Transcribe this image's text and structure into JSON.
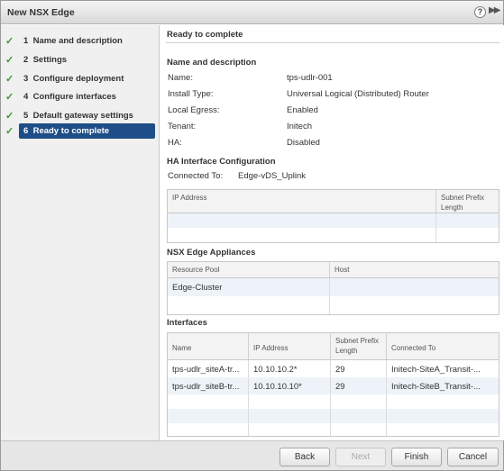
{
  "window": {
    "title": "New NSX Edge",
    "help_glyph": "?",
    "expand_glyph": "▶▶"
  },
  "steps": [
    {
      "num": "1",
      "label": "Name and description",
      "done": true
    },
    {
      "num": "2",
      "label": "Settings",
      "done": true
    },
    {
      "num": "3",
      "label": "Configure deployment",
      "done": true
    },
    {
      "num": "4",
      "label": "Configure interfaces",
      "done": true
    },
    {
      "num": "5",
      "label": "Default gateway settings",
      "done": true
    },
    {
      "num": "6",
      "label": "Ready to complete",
      "done": true,
      "active": true
    }
  ],
  "check_glyph": "✓",
  "page": {
    "title": "Ready to complete",
    "name_section": {
      "heading": "Name and description",
      "rows": [
        {
          "label": "Name:",
          "value": "tps-udlr-001"
        },
        {
          "label": "Install Type:",
          "value": "Universal Logical (Distributed) Router"
        },
        {
          "label": "Local Egress:",
          "value": "Enabled"
        },
        {
          "label": "Tenant:",
          "value": "Initech"
        },
        {
          "label": "HA:",
          "value": "Disabled"
        }
      ]
    },
    "ha_section": {
      "heading": "HA Interface Configuration",
      "connected_label": "Connected To:",
      "connected_value": "Edge-vDS_Uplink",
      "columns": [
        "IP Address",
        "Subnet Prefix Length"
      ]
    },
    "appliances_section": {
      "heading": "NSX Edge Appliances",
      "columns": [
        "Resource Pool",
        "Host"
      ],
      "rows": [
        {
          "resource_pool": "Edge-Cluster",
          "host": ""
        }
      ]
    },
    "interfaces_section": {
      "heading": "Interfaces",
      "columns": [
        "Name",
        "IP Address",
        "Subnet Prefix Length",
        "Connected To"
      ],
      "rows": [
        {
          "name": "tps-udlr_siteA-tr...",
          "ip": "10.10.10.2*",
          "prefix": "29",
          "connected": "Initech-SiteA_Transit-..."
        },
        {
          "name": "tps-udlr_siteB-tr...",
          "ip": "10.10.10.10*",
          "prefix": "29",
          "connected": "Initech-SiteB_Transit-..."
        }
      ]
    }
  },
  "buttons": {
    "back": "Back",
    "next": "Next",
    "finish": "Finish",
    "cancel": "Cancel"
  }
}
